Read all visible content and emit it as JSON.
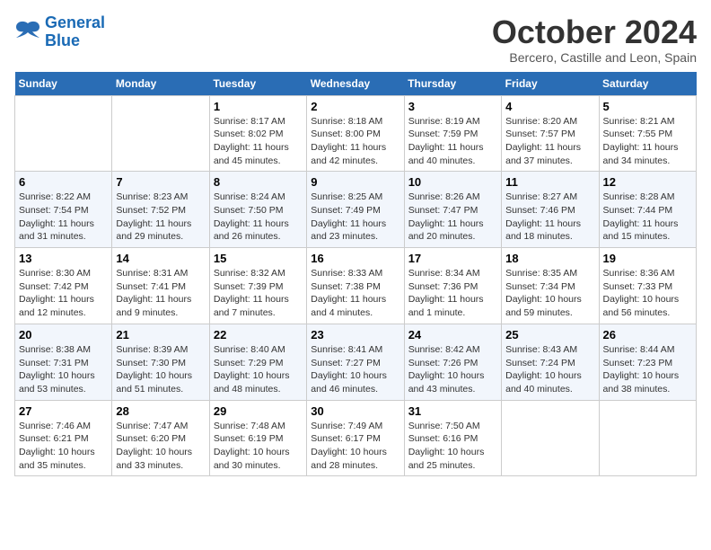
{
  "logo": {
    "line1": "General",
    "line2": "Blue"
  },
  "title": "October 2024",
  "subtitle": "Bercero, Castille and Leon, Spain",
  "weekdays": [
    "Sunday",
    "Monday",
    "Tuesday",
    "Wednesday",
    "Thursday",
    "Friday",
    "Saturday"
  ],
  "weeks": [
    [
      {
        "day": "",
        "info": ""
      },
      {
        "day": "",
        "info": ""
      },
      {
        "day": "1",
        "info": "Sunrise: 8:17 AM\nSunset: 8:02 PM\nDaylight: 11 hours and 45 minutes."
      },
      {
        "day": "2",
        "info": "Sunrise: 8:18 AM\nSunset: 8:00 PM\nDaylight: 11 hours and 42 minutes."
      },
      {
        "day": "3",
        "info": "Sunrise: 8:19 AM\nSunset: 7:59 PM\nDaylight: 11 hours and 40 minutes."
      },
      {
        "day": "4",
        "info": "Sunrise: 8:20 AM\nSunset: 7:57 PM\nDaylight: 11 hours and 37 minutes."
      },
      {
        "day": "5",
        "info": "Sunrise: 8:21 AM\nSunset: 7:55 PM\nDaylight: 11 hours and 34 minutes."
      }
    ],
    [
      {
        "day": "6",
        "info": "Sunrise: 8:22 AM\nSunset: 7:54 PM\nDaylight: 11 hours and 31 minutes."
      },
      {
        "day": "7",
        "info": "Sunrise: 8:23 AM\nSunset: 7:52 PM\nDaylight: 11 hours and 29 minutes."
      },
      {
        "day": "8",
        "info": "Sunrise: 8:24 AM\nSunset: 7:50 PM\nDaylight: 11 hours and 26 minutes."
      },
      {
        "day": "9",
        "info": "Sunrise: 8:25 AM\nSunset: 7:49 PM\nDaylight: 11 hours and 23 minutes."
      },
      {
        "day": "10",
        "info": "Sunrise: 8:26 AM\nSunset: 7:47 PM\nDaylight: 11 hours and 20 minutes."
      },
      {
        "day": "11",
        "info": "Sunrise: 8:27 AM\nSunset: 7:46 PM\nDaylight: 11 hours and 18 minutes."
      },
      {
        "day": "12",
        "info": "Sunrise: 8:28 AM\nSunset: 7:44 PM\nDaylight: 11 hours and 15 minutes."
      }
    ],
    [
      {
        "day": "13",
        "info": "Sunrise: 8:30 AM\nSunset: 7:42 PM\nDaylight: 11 hours and 12 minutes."
      },
      {
        "day": "14",
        "info": "Sunrise: 8:31 AM\nSunset: 7:41 PM\nDaylight: 11 hours and 9 minutes."
      },
      {
        "day": "15",
        "info": "Sunrise: 8:32 AM\nSunset: 7:39 PM\nDaylight: 11 hours and 7 minutes."
      },
      {
        "day": "16",
        "info": "Sunrise: 8:33 AM\nSunset: 7:38 PM\nDaylight: 11 hours and 4 minutes."
      },
      {
        "day": "17",
        "info": "Sunrise: 8:34 AM\nSunset: 7:36 PM\nDaylight: 11 hours and 1 minute."
      },
      {
        "day": "18",
        "info": "Sunrise: 8:35 AM\nSunset: 7:34 PM\nDaylight: 10 hours and 59 minutes."
      },
      {
        "day": "19",
        "info": "Sunrise: 8:36 AM\nSunset: 7:33 PM\nDaylight: 10 hours and 56 minutes."
      }
    ],
    [
      {
        "day": "20",
        "info": "Sunrise: 8:38 AM\nSunset: 7:31 PM\nDaylight: 10 hours and 53 minutes."
      },
      {
        "day": "21",
        "info": "Sunrise: 8:39 AM\nSunset: 7:30 PM\nDaylight: 10 hours and 51 minutes."
      },
      {
        "day": "22",
        "info": "Sunrise: 8:40 AM\nSunset: 7:29 PM\nDaylight: 10 hours and 48 minutes."
      },
      {
        "day": "23",
        "info": "Sunrise: 8:41 AM\nSunset: 7:27 PM\nDaylight: 10 hours and 46 minutes."
      },
      {
        "day": "24",
        "info": "Sunrise: 8:42 AM\nSunset: 7:26 PM\nDaylight: 10 hours and 43 minutes."
      },
      {
        "day": "25",
        "info": "Sunrise: 8:43 AM\nSunset: 7:24 PM\nDaylight: 10 hours and 40 minutes."
      },
      {
        "day": "26",
        "info": "Sunrise: 8:44 AM\nSunset: 7:23 PM\nDaylight: 10 hours and 38 minutes."
      }
    ],
    [
      {
        "day": "27",
        "info": "Sunrise: 7:46 AM\nSunset: 6:21 PM\nDaylight: 10 hours and 35 minutes."
      },
      {
        "day": "28",
        "info": "Sunrise: 7:47 AM\nSunset: 6:20 PM\nDaylight: 10 hours and 33 minutes."
      },
      {
        "day": "29",
        "info": "Sunrise: 7:48 AM\nSunset: 6:19 PM\nDaylight: 10 hours and 30 minutes."
      },
      {
        "day": "30",
        "info": "Sunrise: 7:49 AM\nSunset: 6:17 PM\nDaylight: 10 hours and 28 minutes."
      },
      {
        "day": "31",
        "info": "Sunrise: 7:50 AM\nSunset: 6:16 PM\nDaylight: 10 hours and 25 minutes."
      },
      {
        "day": "",
        "info": ""
      },
      {
        "day": "",
        "info": ""
      }
    ]
  ]
}
